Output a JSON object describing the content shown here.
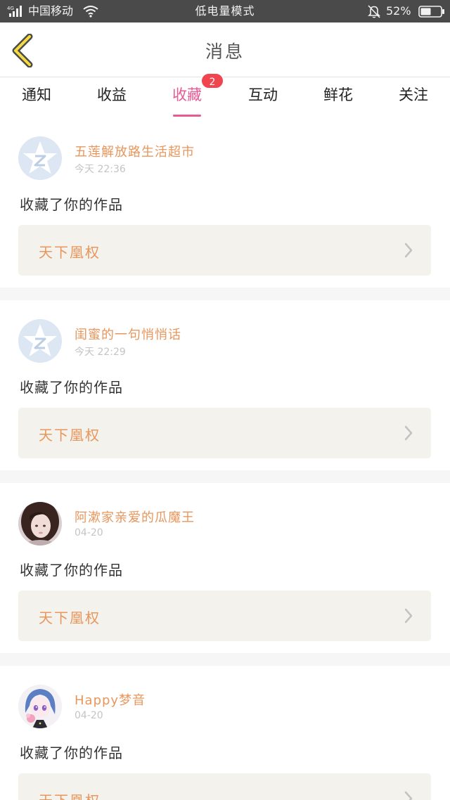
{
  "status_bar": {
    "network": "4G",
    "carrier": "中国移动",
    "mode": "低电量模式",
    "battery": "52%"
  },
  "header": {
    "back_icon": "chevron-left-icon",
    "title": "消息"
  },
  "tabs": [
    {
      "label": "通知",
      "active": false
    },
    {
      "label": "收益",
      "active": false
    },
    {
      "label": "收藏",
      "active": true,
      "badge": "2"
    },
    {
      "label": "互动",
      "active": false
    },
    {
      "label": "鲜花",
      "active": false
    },
    {
      "label": "关注",
      "active": false
    }
  ],
  "colors": {
    "accent": "#e75a93",
    "badge": "#f0444e",
    "name": "#e8965c",
    "card_box": "#f3f2ec"
  },
  "feed": [
    {
      "avatar": "default-star-avatar",
      "username": "五莲解放路生活超市",
      "time": "今天 22:36",
      "action": "收藏了你的作品",
      "work_title": "天下凰权"
    },
    {
      "avatar": "default-star-avatar",
      "username": "闺蜜的一句悄悄话",
      "time": "今天 22:29",
      "action": "收藏了你的作品",
      "work_title": "天下凰权"
    },
    {
      "avatar": "photo-avatar-girl",
      "username": "阿漱家亲爱的瓜魔王",
      "time": "04-20",
      "action": "收藏了你的作品",
      "work_title": "天下凰权"
    },
    {
      "avatar": "anime-avatar",
      "username": "Happy梦音",
      "time": "04-20",
      "action": "收藏了你的作品",
      "work_title": "天下凰权"
    }
  ]
}
